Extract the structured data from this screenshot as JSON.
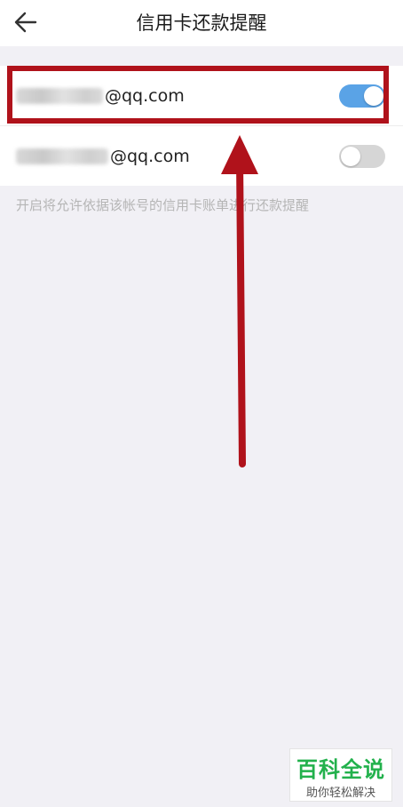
{
  "header": {
    "title": "信用卡还款提醒",
    "back_icon": "back-arrow-icon"
  },
  "accounts": [
    {
      "email_suffix": "@qq.com",
      "enabled": true
    },
    {
      "email_suffix": "@qq.com",
      "enabled": false
    }
  ],
  "hint": "开启将允许依据该帐号的信用卡账单进行还款提醒",
  "colors": {
    "toggle_on": "#5aa3e6",
    "toggle_off": "#d6d6d6",
    "annotation": "#b0121b"
  },
  "watermark": {
    "main": "百科全说",
    "sub": "助你轻松解决"
  }
}
